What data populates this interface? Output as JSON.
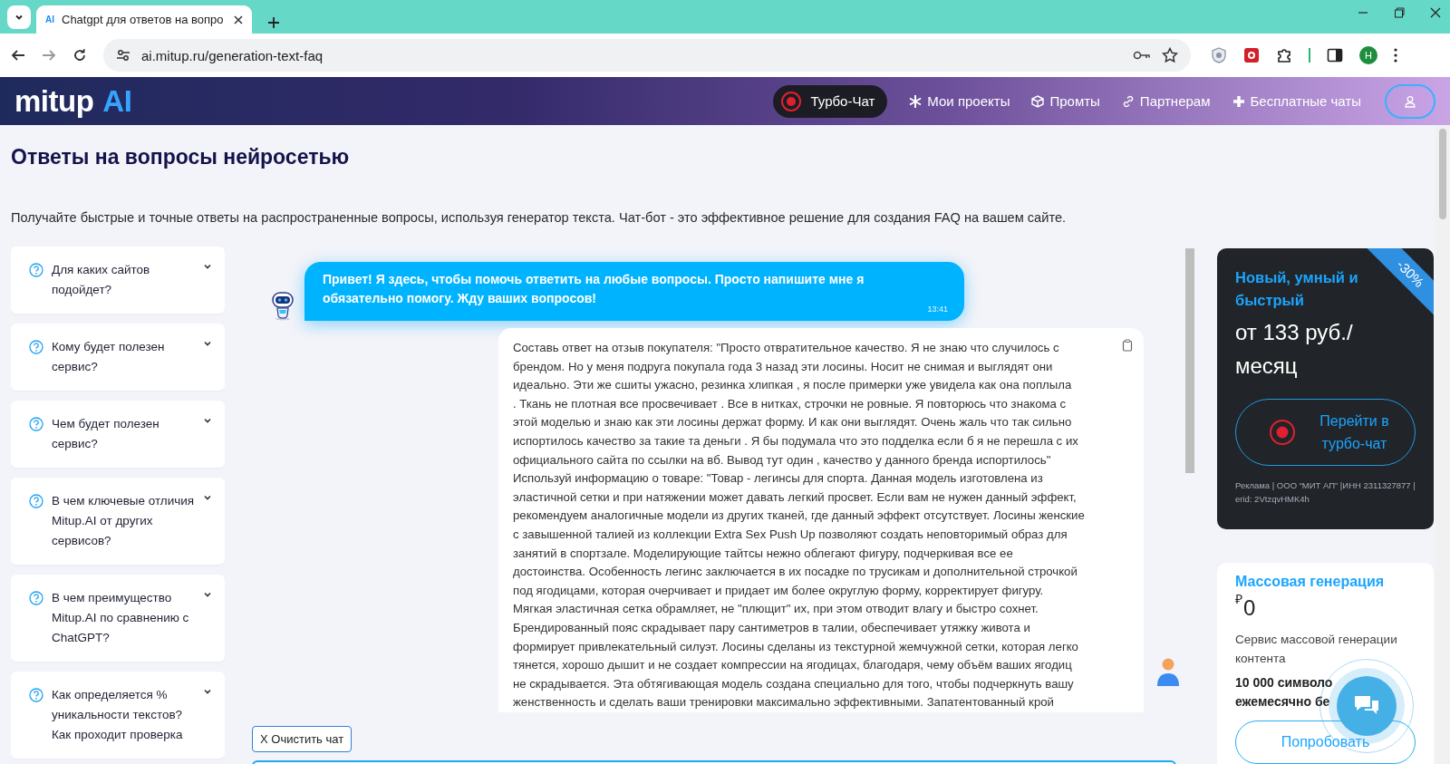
{
  "browser": {
    "tab_icon": "AI",
    "tab_title": "Chatgpt для ответов на вопро",
    "url": "ai.mitup.ru/generation-text-faq",
    "profile_initial": "H"
  },
  "header": {
    "logo": "mitup",
    "logo_accent": "AI",
    "nav": [
      {
        "label": "Турбо-Чат",
        "kind": "turbo"
      },
      {
        "label": "Мои проекты",
        "kind": "projects"
      },
      {
        "label": "Промты",
        "kind": "prompts"
      },
      {
        "label": "Партнерам",
        "kind": "partners"
      },
      {
        "label": "Бесплатные чаты",
        "kind": "free"
      }
    ]
  },
  "page": {
    "title": "Ответы на вопросы нейросетью",
    "description": "Получайте быстрые и точные ответы на распространенные вопросы, используя генератор текста. Чат-бот - это эффективное решение для создания FAQ на вашем сайте."
  },
  "faq": [
    {
      "question": "Для каких сайтов подойдет?",
      "expanded": false
    },
    {
      "question": "Кому будет полезен сервис?",
      "expanded": false
    },
    {
      "question": "Чем будет полезен сервис?",
      "expanded": false
    },
    {
      "question": "В чем ключевые отличия Mitup.AI от других сервисов?",
      "expanded": false
    },
    {
      "question": "В чем преимущество Mitup.AI по сравнению с ChatGPT?",
      "expanded": false
    },
    {
      "question": "Как определяется % уникальности текстов? Как проходит проверка",
      "expanded": false
    }
  ],
  "chat": {
    "messages": [
      {
        "kind": "bot",
        "text": "Привет! Я здесь, чтобы помочь ответить на любые вопросы. Просто напишите мне я обязательно помогу. Жду ваших вопросов!",
        "time": "13:41"
      },
      {
        "kind": "user",
        "text": "Составь ответ на отзыв покупателя: \"Просто отвратительное качество. Я не знаю что случилось с\nбрендом. Но у меня подруга покупала года 3 назад эти лосины. Носит не снимая и выглядят они\nидеально. Эти же сшиты ужасно, резинка хлипкая , я после примерки уже увидела как она поплыла\n. Ткань не плотная все просвечивает . Все в нитках, строчки не ровные. Я повторюсь что знакома с\nэтой моделью и знаю как эти лосины держат форму. И как они выглядят. Очень жаль что так сильно\nиспортилось качество за такие та деньги . Я бы подумала что это подделка если б я не перешла с их\nофициального сайта по ссылки на вб. Вывод тут один , качество у данного бренда испортилось\"\nИспользуй информацию о товаре: \"Товар - легинсы для спорта. Данная модель изготовлена из\nэластичной сетки и при натяжении может давать легкий просвет. Если вам не нужен данный эффект,\nрекомендуем аналогичные модели из других тканей, где данный эффект отсутствует. Лосины женские\nс завышенной талией из коллекции Extra Sex Push Up позволяют создать неповторимый образ для\nзанятий в спортзале. Моделирующие тайтсы нежно облегают фигуру, подчеркивая все ее\nдостоинства. Особенность легинс заключается в их посадке по трусикам и дополнительной строчкой\nпод ягодицами, которая очерчивает и придает им более округлую форму, корректирует фигуру.\nМягкая эластичная сетка обрамляет, не \"плющит\" их, при этом отводит влагу и быстро сохнет.\nБрендированный пояс скрадывает пару сантиметров в талии, обеспечивает утяжку живота и\nформирует привлекательный силуэт. Лосины сделаны из текстурной жемчужной сетки, которая легко\nтянется, хорошо дышит и не создает компрессии на ягодицах, благодаря, чему объём ваших ягодиц\nне скрадывается. Эта обтягивающая модель создана специально для того, чтобы подчеркнуть вашу\nженственность и сделать ваши тренировки максимально эффективными. Запатентованный крой"
      }
    ],
    "clear_button": "X Очистить чат"
  },
  "promo": {
    "badge": "-30%",
    "title": "Новый, умный и быстрый",
    "price": "от 133 руб./ месяц",
    "button": "Перейти в турбо-чат",
    "disclaimer": "Реклама | ООО “МИТ АП” |ИНН 2311327877 | erid: 2VtzqvHMK4h"
  },
  "mass": {
    "title": "Массовая генерация",
    "currency": "₽",
    "amount": "0",
    "description": "Сервис массовой генерации контента",
    "feature_lines": [
      "10 000 символо",
      "ежемесячно бе"
    ],
    "button": "Попробовать"
  }
}
